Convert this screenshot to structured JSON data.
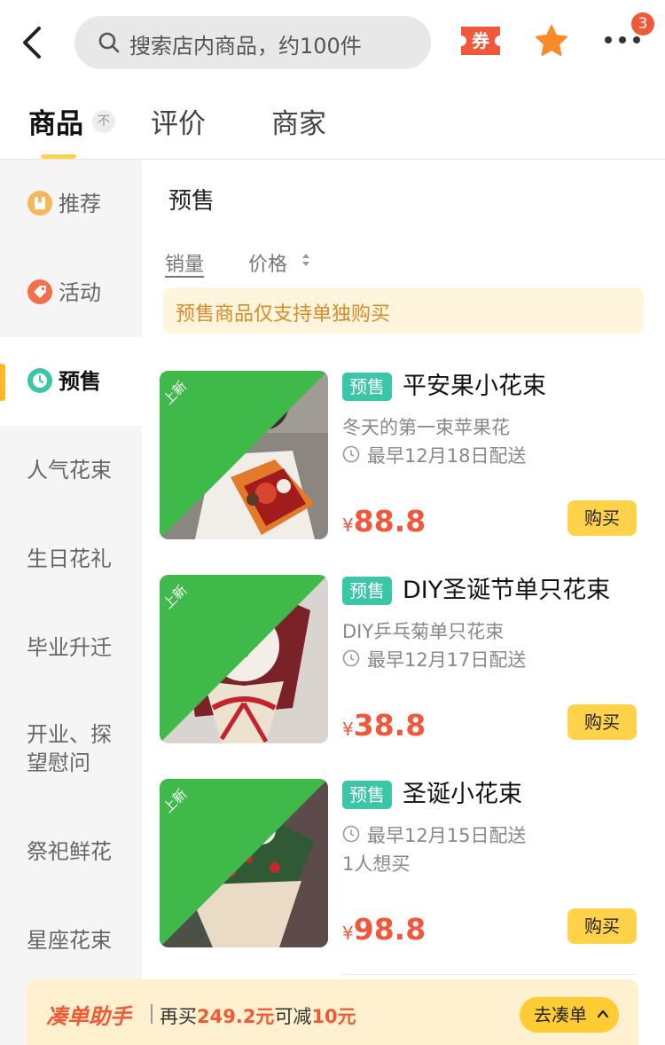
{
  "search": {
    "placeholder": "搜索店内商品，约100件"
  },
  "header": {
    "coupon_label": "券",
    "more_badge": "3"
  },
  "tabs": [
    {
      "label": "商品",
      "sort_hint": "不"
    },
    {
      "label": "评价"
    },
    {
      "label": "商家"
    }
  ],
  "sidebar": {
    "items": [
      {
        "label": "推荐",
        "icon": "recommend-icon"
      },
      {
        "label": "活动",
        "icon": "tag-icon"
      },
      {
        "label": "预售",
        "icon": "clock-icon"
      },
      {
        "label": "人气花束"
      },
      {
        "label": "生日花礼"
      },
      {
        "label": "毕业升迁"
      },
      {
        "label": "开业、探望慰问"
      },
      {
        "label": "祭祀鲜花"
      },
      {
        "label": "星座花束"
      }
    ]
  },
  "main": {
    "section_title": "预售",
    "sort_sales": "销量",
    "sort_price": "价格",
    "notice": "预售商品仅支持单独购买"
  },
  "products": [
    {
      "new_tag": "上新",
      "presale_tag": "预售",
      "name": "平安果小花束",
      "subtitle": "冬天的第一束苹果花",
      "delivery": "最早12月18日配送",
      "currency": "¥",
      "price": "88.8",
      "buy_label": "购买"
    },
    {
      "new_tag": "上新",
      "presale_tag": "预售",
      "name": "DIY圣诞节单只花束",
      "subtitle": "DIY乒乓菊单只花束",
      "delivery": "最早12月17日配送",
      "currency": "¥",
      "price": "38.8",
      "buy_label": "购买"
    },
    {
      "new_tag": "上新",
      "presale_tag": "预售",
      "name": "圣诞小花束",
      "delivery": "最早12月15日配送",
      "extra": "1人想买",
      "currency": "¥",
      "price": "98.8",
      "buy_label": "购买"
    }
  ],
  "bottom_bar": {
    "brand": "凑单助手",
    "msg_prefix": "再买",
    "msg_amount": "249.2元",
    "msg_middle": "可减",
    "msg_discount": "10元",
    "button_label": "去凑单"
  },
  "colors": {
    "accent_yellow": "#ffd24a",
    "price_red": "#f0573b",
    "presale_green": "#3cc6a8",
    "new_green": "#3fb94a",
    "notice_text": "#d98b2b"
  }
}
